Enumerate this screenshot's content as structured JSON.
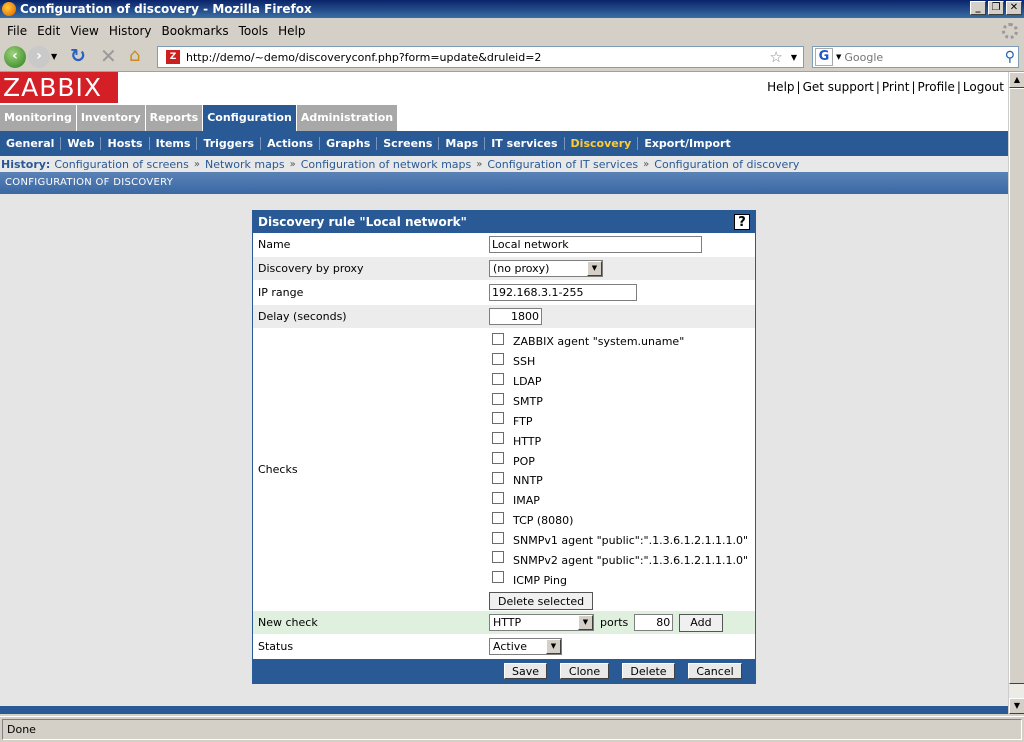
{
  "window": {
    "title": "Configuration of discovery - Mozilla Firefox"
  },
  "menu": [
    "File",
    "Edit",
    "View",
    "History",
    "Bookmarks",
    "Tools",
    "Help"
  ],
  "browser": {
    "url": "http://demo/~demo/discoveryconf.php?form=update&druleid=2",
    "search_placeholder": "Google"
  },
  "app": {
    "logo": "ZABBIX",
    "top_links": [
      "Help",
      "Get support",
      "Print",
      "Profile",
      "Logout"
    ],
    "main_tabs": [
      "Monitoring",
      "Inventory",
      "Reports",
      "Configuration",
      "Administration"
    ],
    "sub_nav": [
      "General",
      "Web",
      "Hosts",
      "Items",
      "Triggers",
      "Actions",
      "Graphs",
      "Screens",
      "Maps",
      "IT services",
      "Discovery",
      "Export/Import"
    ],
    "history_label": "History:",
    "history": [
      "Configuration of screens",
      "Network maps",
      "Configuration of network maps",
      "Configuration of IT services",
      "Configuration of discovery"
    ],
    "section_header": "CONFIGURATION OF DISCOVERY"
  },
  "form": {
    "title": "Discovery rule \"Local network\"",
    "name_label": "Name",
    "name_value": "Local network",
    "proxy_label": "Discovery by proxy",
    "proxy_value": "(no proxy)",
    "ip_label": "IP range",
    "ip_value": "192.168.3.1-255",
    "delay_label": "Delay (seconds)",
    "delay_value": "1800",
    "checks_label": "Checks",
    "checks": [
      "ZABBIX agent \"system.uname\"",
      "SSH",
      "LDAP",
      "SMTP",
      "FTP",
      "HTTP",
      "POP",
      "NNTP",
      "IMAP",
      "TCP (8080)",
      "SNMPv1 agent \"public\":\".1.3.6.1.2.1.1.1.0\"",
      "SNMPv2 agent \"public\":\".1.3.6.1.2.1.1.1.0\"",
      "ICMP Ping"
    ],
    "delete_selected": "Delete selected",
    "new_check_label": "New check",
    "new_check_value": "HTTP",
    "ports_label": "ports",
    "ports_value": "80",
    "add_label": "Add",
    "status_label": "Status",
    "status_value": "Active",
    "buttons": [
      "Save",
      "Clone",
      "Delete",
      "Cancel"
    ]
  },
  "statusbar": {
    "text": "Done"
  }
}
